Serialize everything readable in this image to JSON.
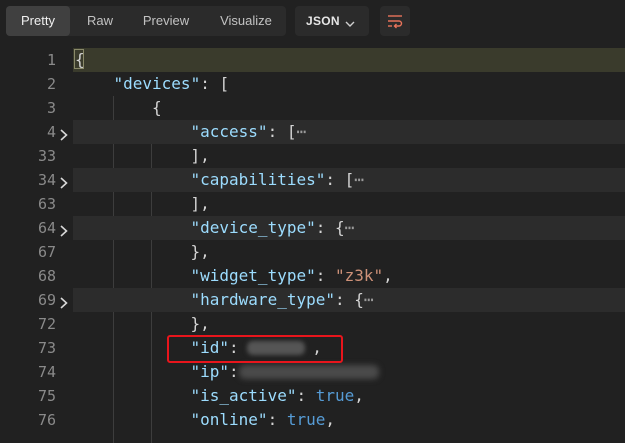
{
  "toolbar": {
    "tabs": [
      {
        "label": "Pretty",
        "active": true
      },
      {
        "label": "Raw",
        "active": false
      },
      {
        "label": "Preview",
        "active": false
      },
      {
        "label": "Visualize",
        "active": false
      }
    ],
    "format": {
      "label": "JSON",
      "icon": "chevron-down-icon"
    },
    "wrap_icon": "wrap-lines-icon"
  },
  "lines": [
    {
      "num": "1",
      "foldable": false,
      "indent": 0,
      "tokens": [
        {
          "t": "punc",
          "v": "{"
        }
      ]
    },
    {
      "num": "2",
      "foldable": false,
      "indent": 1,
      "tokens": [
        {
          "t": "key",
          "v": "\"devices\""
        },
        {
          "t": "punc",
          "v": ": ["
        }
      ]
    },
    {
      "num": "3",
      "foldable": false,
      "indent": 2,
      "tokens": [
        {
          "t": "punc",
          "v": "{"
        }
      ]
    },
    {
      "num": "4",
      "foldable": true,
      "indent": 3,
      "tokens": [
        {
          "t": "key",
          "v": "\"access\""
        },
        {
          "t": "punc",
          "v": ": ["
        },
        {
          "t": "ell",
          "v": "⋯"
        }
      ]
    },
    {
      "num": "33",
      "foldable": false,
      "indent": 3,
      "tokens": [
        {
          "t": "punc",
          "v": "],"
        }
      ]
    },
    {
      "num": "34",
      "foldable": true,
      "indent": 3,
      "tokens": [
        {
          "t": "key",
          "v": "\"capabilities\""
        },
        {
          "t": "punc",
          "v": ": ["
        },
        {
          "t": "ell",
          "v": "⋯"
        }
      ]
    },
    {
      "num": "63",
      "foldable": false,
      "indent": 3,
      "tokens": [
        {
          "t": "punc",
          "v": "],"
        }
      ]
    },
    {
      "num": "64",
      "foldable": true,
      "indent": 3,
      "tokens": [
        {
          "t": "key",
          "v": "\"device_type\""
        },
        {
          "t": "punc",
          "v": ": {"
        },
        {
          "t": "ell",
          "v": "⋯"
        }
      ]
    },
    {
      "num": "67",
      "foldable": false,
      "indent": 3,
      "tokens": [
        {
          "t": "punc",
          "v": "},"
        }
      ]
    },
    {
      "num": "68",
      "foldable": false,
      "indent": 3,
      "tokens": [
        {
          "t": "key",
          "v": "\"widget_type\""
        },
        {
          "t": "punc",
          "v": ": "
        },
        {
          "t": "str",
          "v": "\"z3k\""
        },
        {
          "t": "punc",
          "v": ","
        }
      ]
    },
    {
      "num": "69",
      "foldable": true,
      "indent": 3,
      "tokens": [
        {
          "t": "key",
          "v": "\"hardware_type\""
        },
        {
          "t": "punc",
          "v": ": {"
        },
        {
          "t": "ell",
          "v": "⋯"
        }
      ]
    },
    {
      "num": "72",
      "foldable": false,
      "indent": 3,
      "tokens": [
        {
          "t": "punc",
          "v": "},"
        }
      ]
    },
    {
      "num": "73",
      "foldable": false,
      "indent": 3,
      "tokens": [
        {
          "t": "key",
          "v": "\"id\""
        },
        {
          "t": "punc",
          "v": ": "
        },
        {
          "t": "redacted",
          "v": ""
        },
        {
          "t": "punc",
          "v": ","
        }
      ]
    },
    {
      "num": "74",
      "foldable": false,
      "indent": 3,
      "tokens": [
        {
          "t": "key",
          "v": "\"ip\""
        },
        {
          "t": "punc",
          "v": ": "
        },
        {
          "t": "redacted2",
          "v": ""
        }
      ]
    },
    {
      "num": "75",
      "foldable": false,
      "indent": 3,
      "tokens": [
        {
          "t": "key",
          "v": "\"is_active\""
        },
        {
          "t": "punc",
          "v": ": "
        },
        {
          "t": "lit",
          "v": "true"
        },
        {
          "t": "punc",
          "v": ","
        }
      ]
    },
    {
      "num": "76",
      "foldable": false,
      "indent": 3,
      "tokens": [
        {
          "t": "key",
          "v": "\"online\""
        },
        {
          "t": "punc",
          "v": ": "
        },
        {
          "t": "lit",
          "v": "true"
        },
        {
          "t": "punc",
          "v": ","
        }
      ]
    }
  ]
}
